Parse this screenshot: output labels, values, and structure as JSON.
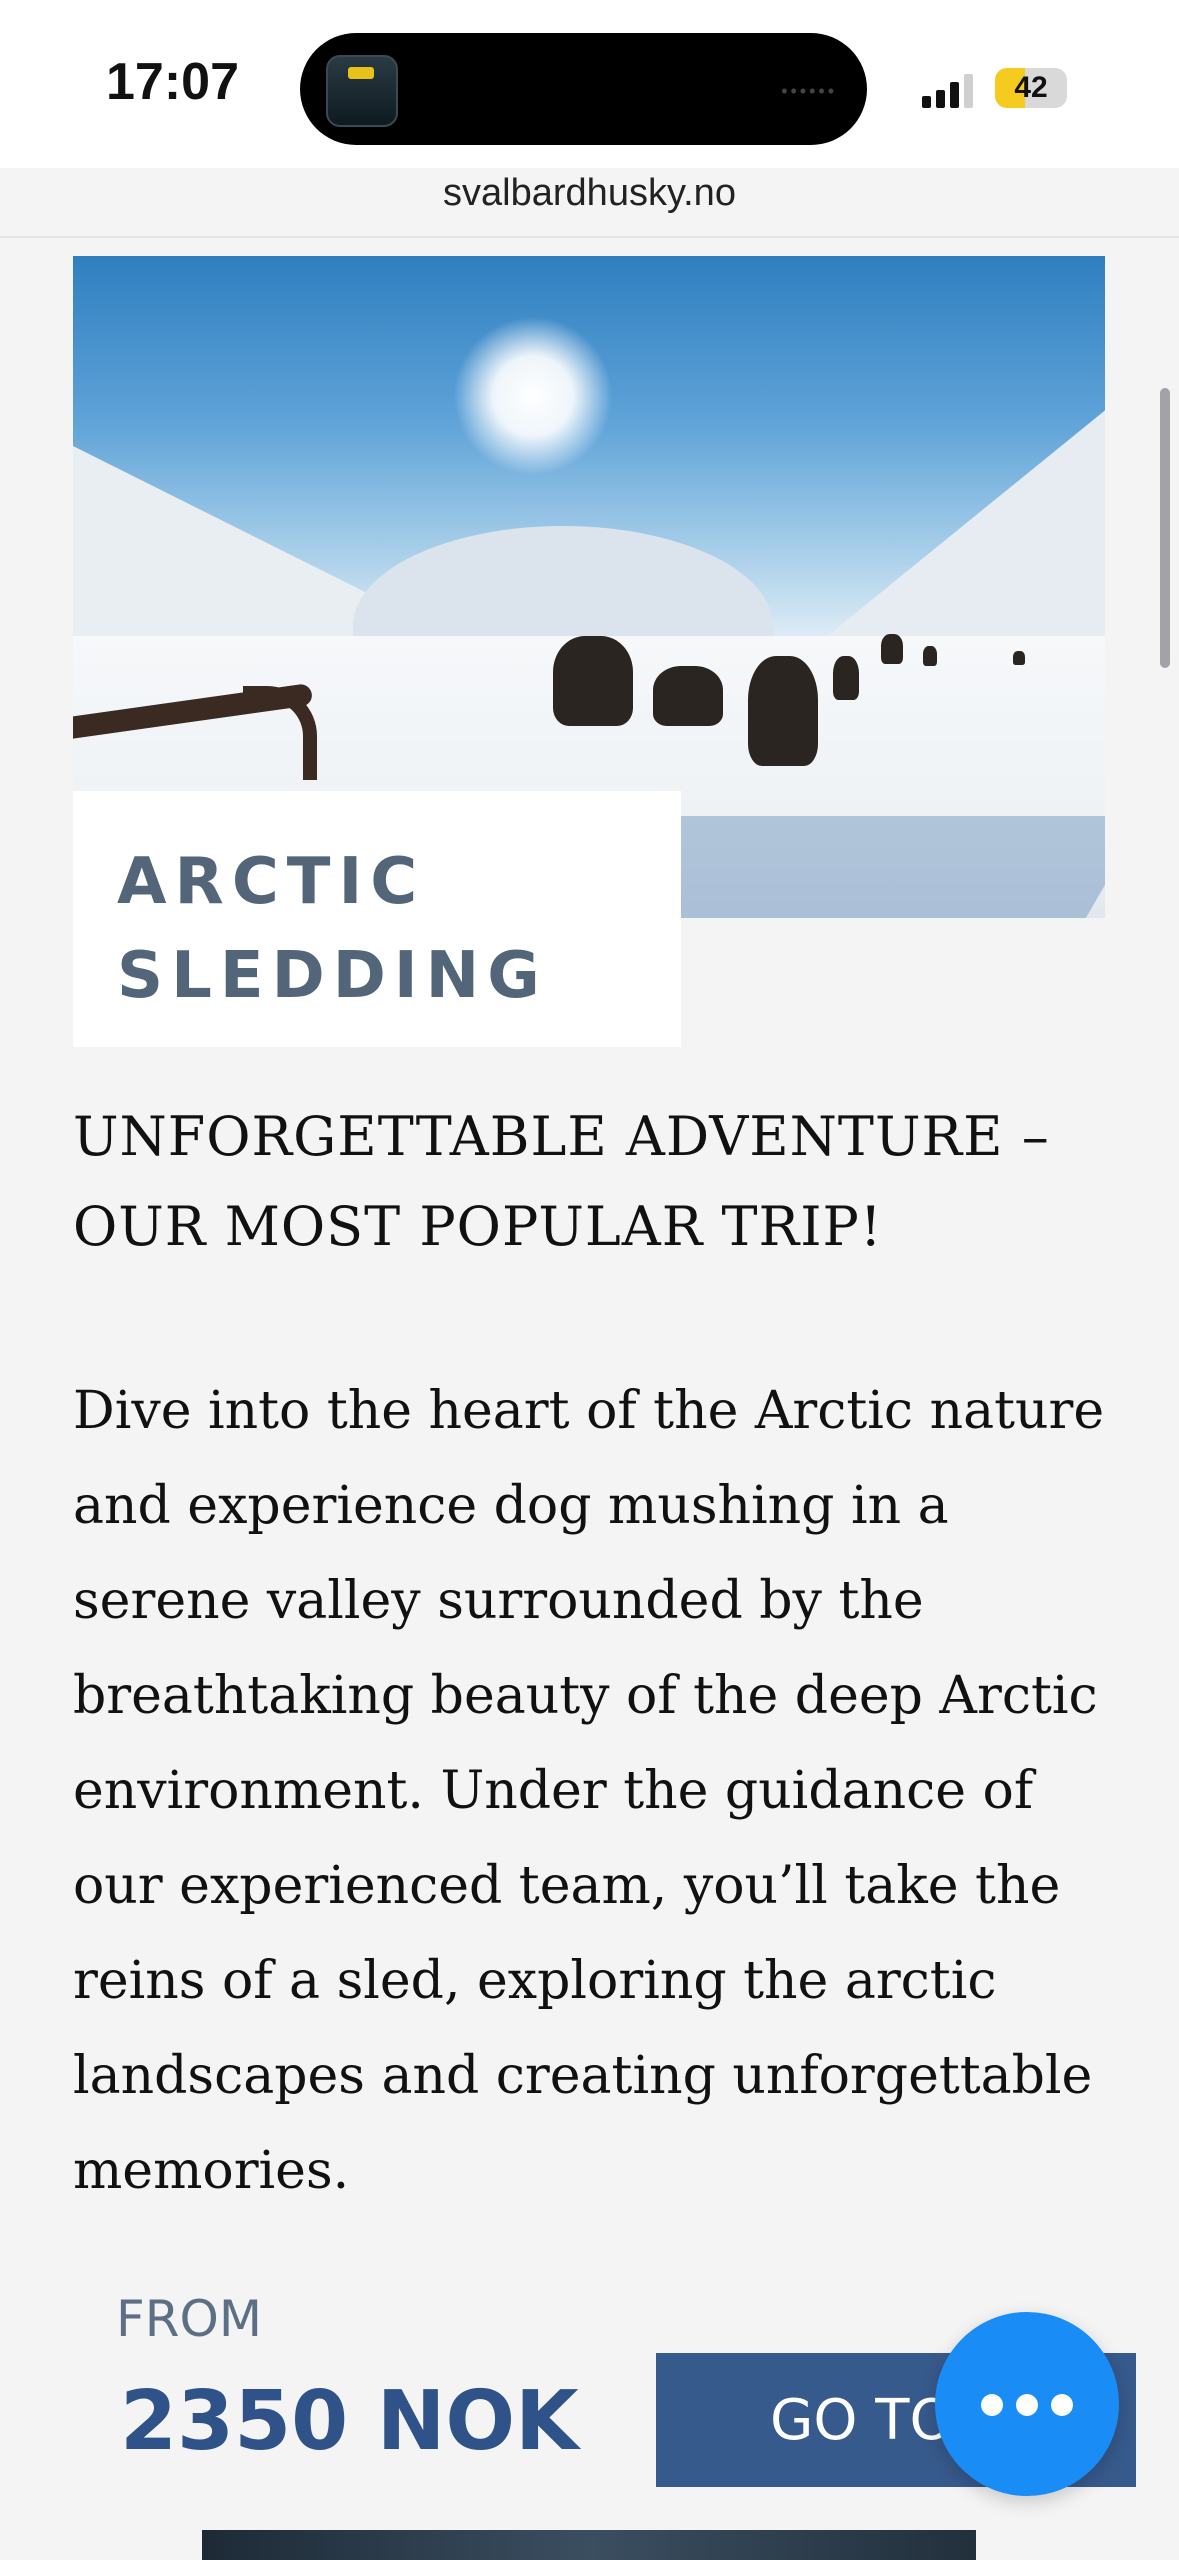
{
  "status_bar": {
    "time": "17:07",
    "battery": "42",
    "battery_level": 0.42
  },
  "browser": {
    "url": "svalbardhusky.no"
  },
  "hero": {
    "icon": "dog-sledding-photo"
  },
  "card": {
    "title": "ARCTIC\nSLEDDING"
  },
  "content": {
    "subtitle": "UNFORGETTABLE ADVENTURE – OUR MOST POPULAR TRIP!",
    "description": "Dive into the heart of the Arctic nature and experience dog mushing in a serene valley surrounded by the breathtaking beauty of the deep Arctic environment. Under the guidance of our experienced team, you’ll take the reins of a sled, exploring the arctic landscapes and creating unforgettable memories."
  },
  "pricing": {
    "from_label": "FROM",
    "price": "2350 NOK",
    "button_label": "GO TO"
  },
  "chat": {
    "icon": "chat-dots-icon"
  },
  "colors": {
    "accent": "#375a8c",
    "price": "#2f5288",
    "chat": "#1a8cf5",
    "title": "#536679"
  }
}
